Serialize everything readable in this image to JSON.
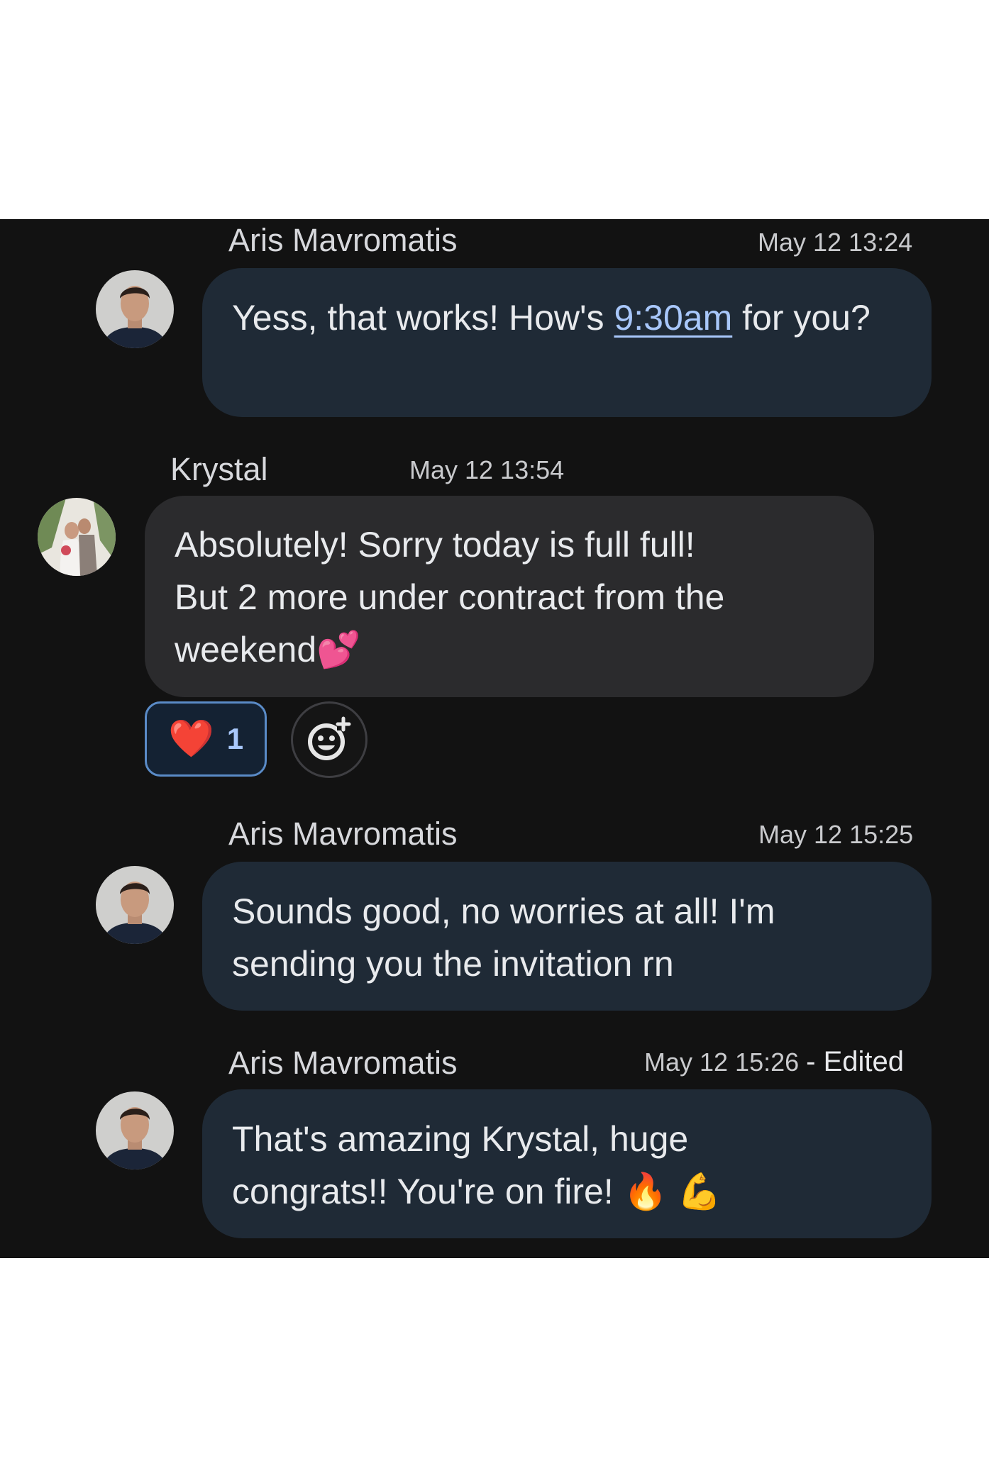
{
  "messages": [
    {
      "sender": "Aris Mavromatis",
      "time": "May 12 13:24",
      "text_before_link": "Yess, that works! How's ",
      "link": "9:30am",
      "text_after_link": " for you?"
    },
    {
      "sender": "Krystal",
      "time": "May 12 13:54",
      "lines": [
        "Absolutely! Sorry today is full full!",
        "But 2 more under contract from the",
        "weekend"
      ],
      "emoji": "💕",
      "reaction": {
        "emoji": "❤️",
        "count": "1"
      }
    },
    {
      "sender": "Aris Mavromatis",
      "time": "May 12 15:25",
      "lines": [
        "Sounds good, no worries at all! I'm",
        "sending you the invitation rn"
      ]
    },
    {
      "sender": "Aris Mavromatis",
      "time": "May 12 15:26",
      "edited": "- Edited",
      "lines": [
        "That's amazing Krystal, huge",
        "congrats!! You're on fire!"
      ],
      "emojis": "🔥 💪"
    }
  ],
  "icons": {
    "add_reaction": "add-reaction-icon",
    "avatar_aris": "avatar-aris",
    "avatar_krystal": "avatar-krystal"
  },
  "colors": {
    "background": "#121212",
    "outgoing_bubble": "#1f2a36",
    "incoming_bubble": "#2b2b2d",
    "link": "#a8c7fa",
    "reaction_border": "#5a8bc7"
  }
}
